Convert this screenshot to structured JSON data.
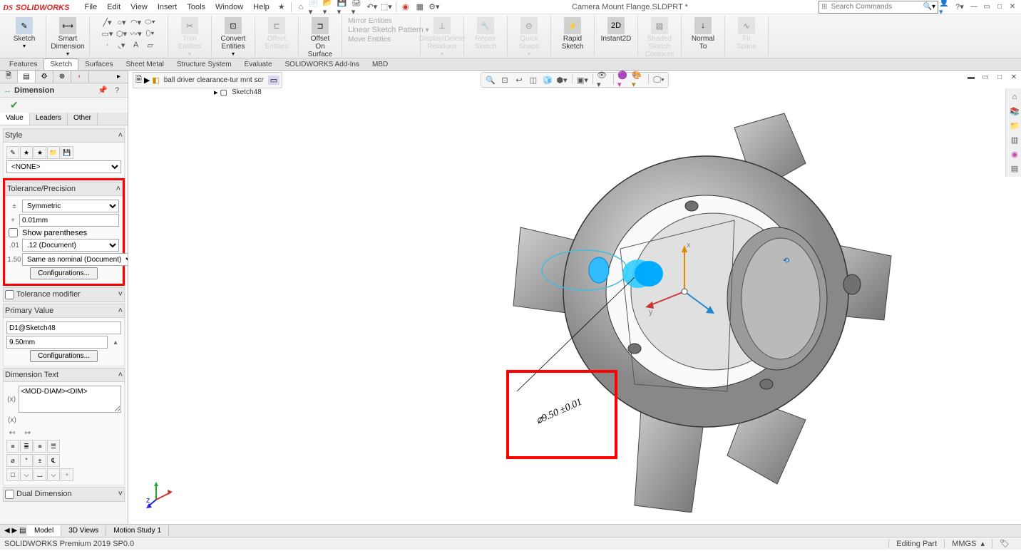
{
  "app": {
    "name": "SOLIDWORKS",
    "doc_title": "Camera Mount Flange.SLDPRT *"
  },
  "menu": [
    "File",
    "Edit",
    "View",
    "Insert",
    "Tools",
    "Window",
    "Help"
  ],
  "search": {
    "placeholder": "Search Commands"
  },
  "ribbon": {
    "sketch": "Sketch",
    "smart_dim": "Smart\nDimension",
    "trim": "Trim\nEntities",
    "convert": "Convert\nEntities",
    "offset": "Offset\nEntities",
    "offset_surface": "Offset\nOn\nSurface",
    "mirror": "Mirror Entities",
    "linear": "Linear Sketch Pattern",
    "move": "Move Entities",
    "display": "Display/Delete\nRelations",
    "repair": "Repair\nSketch",
    "quick": "Quick\nSnaps",
    "rapid": "Rapid\nSketch",
    "instant": "Instant2D",
    "shaded": "Shaded\nSketch\nContours",
    "normal": "Normal\nTo",
    "fit": "Fit\nSpline"
  },
  "tabs": [
    "Features",
    "Sketch",
    "Surfaces",
    "Sheet Metal",
    "Structure System",
    "Evaluate",
    "SOLIDWORKS Add-Ins",
    "MBD"
  ],
  "tabs_active": 1,
  "breadcrumb": {
    "root": "ball driver clearance-tur mnt scr",
    "child": "Sketch48"
  },
  "pm": {
    "title": "Dimension",
    "subtabs": [
      "Value",
      "Leaders",
      "Other"
    ],
    "style": {
      "label": "Style",
      "none": "<NONE>"
    },
    "tolerance": {
      "label": "Tolerance/Precision",
      "type": "Symmetric",
      "plus": "0.01mm",
      "show_paren": "Show parentheses",
      "unit_prec": ".12 (Document)",
      "tol_prec": "Same as nominal (Document)",
      "config": "Configurations..."
    },
    "tol_modifier": "Tolerance modifier",
    "primary": {
      "label": "Primary Value",
      "name": "D1@Sketch48",
      "value": "9.50mm",
      "config": "Configurations..."
    },
    "dimtext": {
      "label": "Dimension Text",
      "value": "<MOD-DIAM><DIM>"
    },
    "dual": "Dual Dimension"
  },
  "viewport": {
    "dimension_label": "⌀9.50 ±0.01"
  },
  "bottom_tabs": [
    "Model",
    "3D Views",
    "Motion Study 1"
  ],
  "status": {
    "product": "SOLIDWORKS Premium 2019 SP0.0",
    "mode": "Editing Part",
    "units": "MMGS"
  }
}
